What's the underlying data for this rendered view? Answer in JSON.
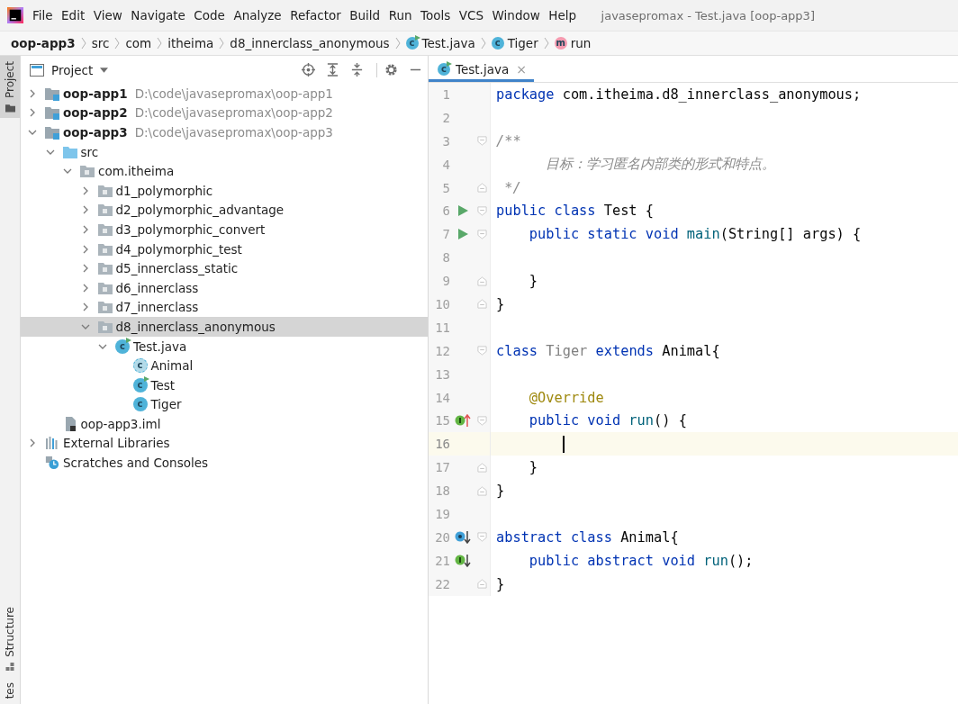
{
  "window": {
    "menu": [
      "File",
      "Edit",
      "View",
      "Navigate",
      "Code",
      "Analyze",
      "Refactor",
      "Build",
      "Run",
      "Tools",
      "VCS",
      "Window",
      "Help"
    ],
    "title": "javasepromax - Test.java [oop-app3]"
  },
  "breadcrumbs": [
    {
      "label": "oop-app3",
      "kind": "project"
    },
    {
      "label": "src",
      "kind": "folder"
    },
    {
      "label": "com",
      "kind": "folder"
    },
    {
      "label": "itheima",
      "kind": "folder"
    },
    {
      "label": "d8_innerclass_anonymous",
      "kind": "folder"
    },
    {
      "label": "Test.java",
      "kind": "class-run",
      "icon_text": "c"
    },
    {
      "label": "Tiger",
      "kind": "class",
      "icon_text": "c"
    },
    {
      "label": "run",
      "kind": "method",
      "icon_text": "m"
    }
  ],
  "side_strip": {
    "top": [
      {
        "label": "Project",
        "selected": true
      }
    ],
    "bottom": [
      {
        "label": "Structure",
        "selected": false
      },
      {
        "label": "tes",
        "selected": false
      }
    ]
  },
  "project_panel": {
    "title": "Project",
    "tree": [
      {
        "label": "oop-app1",
        "path": "D:\\code\\javasepromax\\oop-app1",
        "kind": "module",
        "expanded": false,
        "selected": false
      },
      {
        "label": "oop-app2",
        "path": "D:\\code\\javasepromax\\oop-app2",
        "kind": "module",
        "expanded": false,
        "selected": false
      },
      {
        "label": "oop-app3",
        "path": "D:\\code\\javasepromax\\oop-app3",
        "kind": "module",
        "expanded": true,
        "selected": false,
        "children": [
          {
            "label": "src",
            "kind": "source",
            "expanded": true,
            "selected": false,
            "children": [
              {
                "label": "com.itheima",
                "kind": "package",
                "expanded": true,
                "selected": false,
                "children": [
                  {
                    "label": "d1_polymorphic",
                    "kind": "package",
                    "expanded": false,
                    "selected": false
                  },
                  {
                    "label": "d2_polymorphic_advantage",
                    "kind": "package",
                    "expanded": false,
                    "selected": false
                  },
                  {
                    "label": "d3_polymorphic_convert",
                    "kind": "package",
                    "expanded": false,
                    "selected": false
                  },
                  {
                    "label": "d4_polymorphic_test",
                    "kind": "package",
                    "expanded": false,
                    "selected": false
                  },
                  {
                    "label": "d5_innerclass_static",
                    "kind": "package",
                    "expanded": false,
                    "selected": false
                  },
                  {
                    "label": "d6_innerclass",
                    "kind": "package",
                    "expanded": false,
                    "selected": false
                  },
                  {
                    "label": "d7_innerclass",
                    "kind": "package",
                    "expanded": false,
                    "selected": false
                  },
                  {
                    "label": "d8_innerclass_anonymous",
                    "kind": "package",
                    "expanded": true,
                    "selected": true,
                    "children": [
                      {
                        "label": "Test.java",
                        "kind": "runnable",
                        "icon_text": "c",
                        "expanded": true,
                        "selected": false,
                        "children": [
                          {
                            "label": "Animal",
                            "kind": "abstract",
                            "icon_text": "c",
                            "selected": false
                          },
                          {
                            "label": "Test",
                            "kind": "runnable",
                            "icon_text": "c",
                            "selected": false
                          },
                          {
                            "label": "Tiger",
                            "kind": "class",
                            "icon_text": "c",
                            "selected": false
                          }
                        ]
                      }
                    ]
                  }
                ]
              }
            ]
          },
          {
            "label": "oop-app3.iml",
            "kind": "file",
            "selected": false
          }
        ]
      },
      {
        "label": "External Libraries",
        "kind": "libraries",
        "expanded": false,
        "selected": false
      },
      {
        "label": "Scratches and Consoles",
        "kind": "scratches",
        "selected": false
      }
    ]
  },
  "editor": {
    "tabs": [
      {
        "label": "Test.java",
        "icon_text": "c",
        "close": "×",
        "selected": true
      }
    ],
    "lines": [
      {
        "number": "1",
        "current": false,
        "tokens": [
          {
            "text": "package ",
            "kind": "keyword"
          },
          {
            "text": "com.itheima.d8_innerclass_anonymous;",
            "kind": "plain"
          }
        ]
      },
      {
        "number": "2",
        "current": false
      },
      {
        "number": "3",
        "current": false,
        "fold": {
          "kind": "start"
        },
        "tokens": [
          {
            "text": "/**",
            "kind": "comment"
          }
        ]
      },
      {
        "number": "4",
        "current": false,
        "tokens": [
          {
            "text": "      目标：学习匿名内部类的形式和特点。",
            "kind": "comment"
          }
        ]
      },
      {
        "number": "5",
        "current": false,
        "fold": {
          "kind": "end"
        },
        "tokens": [
          {
            "text": " */",
            "kind": "comment"
          }
        ]
      },
      {
        "number": "6",
        "current": false,
        "gutter_icon": {
          "kind": "run"
        },
        "fold": {
          "kind": "start"
        },
        "tokens": [
          {
            "text": "public class ",
            "kind": "keyword"
          },
          {
            "text": "Test {",
            "kind": "plain"
          }
        ]
      },
      {
        "number": "7",
        "current": false,
        "gutter_icon": {
          "kind": "run"
        },
        "fold": {
          "kind": "start"
        },
        "tokens": [
          {
            "text": "    public static void ",
            "kind": "keyword"
          },
          {
            "text": "main",
            "kind": "method"
          },
          {
            "text": "(String[] args) {",
            "kind": "plain"
          }
        ]
      },
      {
        "number": "8",
        "current": false
      },
      {
        "number": "9",
        "current": false,
        "fold": {
          "kind": "end"
        },
        "tokens": [
          {
            "text": "    }",
            "kind": "plain"
          }
        ]
      },
      {
        "number": "10",
        "current": false,
        "fold": {
          "kind": "end"
        },
        "tokens": [
          {
            "text": "}",
            "kind": "plain"
          }
        ]
      },
      {
        "number": "11",
        "current": false
      },
      {
        "number": "12",
        "current": false,
        "fold": {
          "kind": "start"
        },
        "tokens": [
          {
            "text": "class ",
            "kind": "keyword"
          },
          {
            "text": "Tiger",
            "kind": "unused"
          },
          {
            "text": " extends",
            "kind": "keyword"
          },
          {
            "text": " Animal{",
            "kind": "plain"
          }
        ]
      },
      {
        "number": "13",
        "current": false
      },
      {
        "number": "14",
        "current": false,
        "tokens": [
          {
            "text": "    @Override",
            "kind": "annotation"
          }
        ]
      },
      {
        "number": "15",
        "current": false,
        "gutter_icon": {
          "kind": "implements"
        },
        "fold": {
          "kind": "start"
        },
        "tokens": [
          {
            "text": "    public void ",
            "kind": "keyword"
          },
          {
            "text": "run",
            "kind": "method"
          },
          {
            "text": "() {",
            "kind": "plain"
          }
        ]
      },
      {
        "number": "16",
        "current": true
      },
      {
        "number": "17",
        "current": false,
        "fold": {
          "kind": "end"
        },
        "tokens": [
          {
            "text": "    }",
            "kind": "plain"
          }
        ]
      },
      {
        "number": "18",
        "current": false,
        "fold": {
          "kind": "end"
        },
        "tokens": [
          {
            "text": "}",
            "kind": "plain"
          }
        ]
      },
      {
        "number": "19",
        "current": false
      },
      {
        "number": "20",
        "current": false,
        "gutter_icon": {
          "kind": "subclassed"
        },
        "fold": {
          "kind": "start"
        },
        "tokens": [
          {
            "text": "abstract class ",
            "kind": "keyword"
          },
          {
            "text": "Animal{",
            "kind": "plain"
          }
        ]
      },
      {
        "number": "21",
        "current": false,
        "gutter_icon": {
          "kind": "implemented"
        },
        "tokens": [
          {
            "text": "    public abstract void ",
            "kind": "keyword"
          },
          {
            "text": "run",
            "kind": "method"
          },
          {
            "text": "();",
            "kind": "plain"
          }
        ]
      },
      {
        "number": "22",
        "current": false,
        "fold": {
          "kind": "end"
        },
        "tokens": [
          {
            "text": "}",
            "kind": "plain"
          }
        ]
      }
    ]
  }
}
